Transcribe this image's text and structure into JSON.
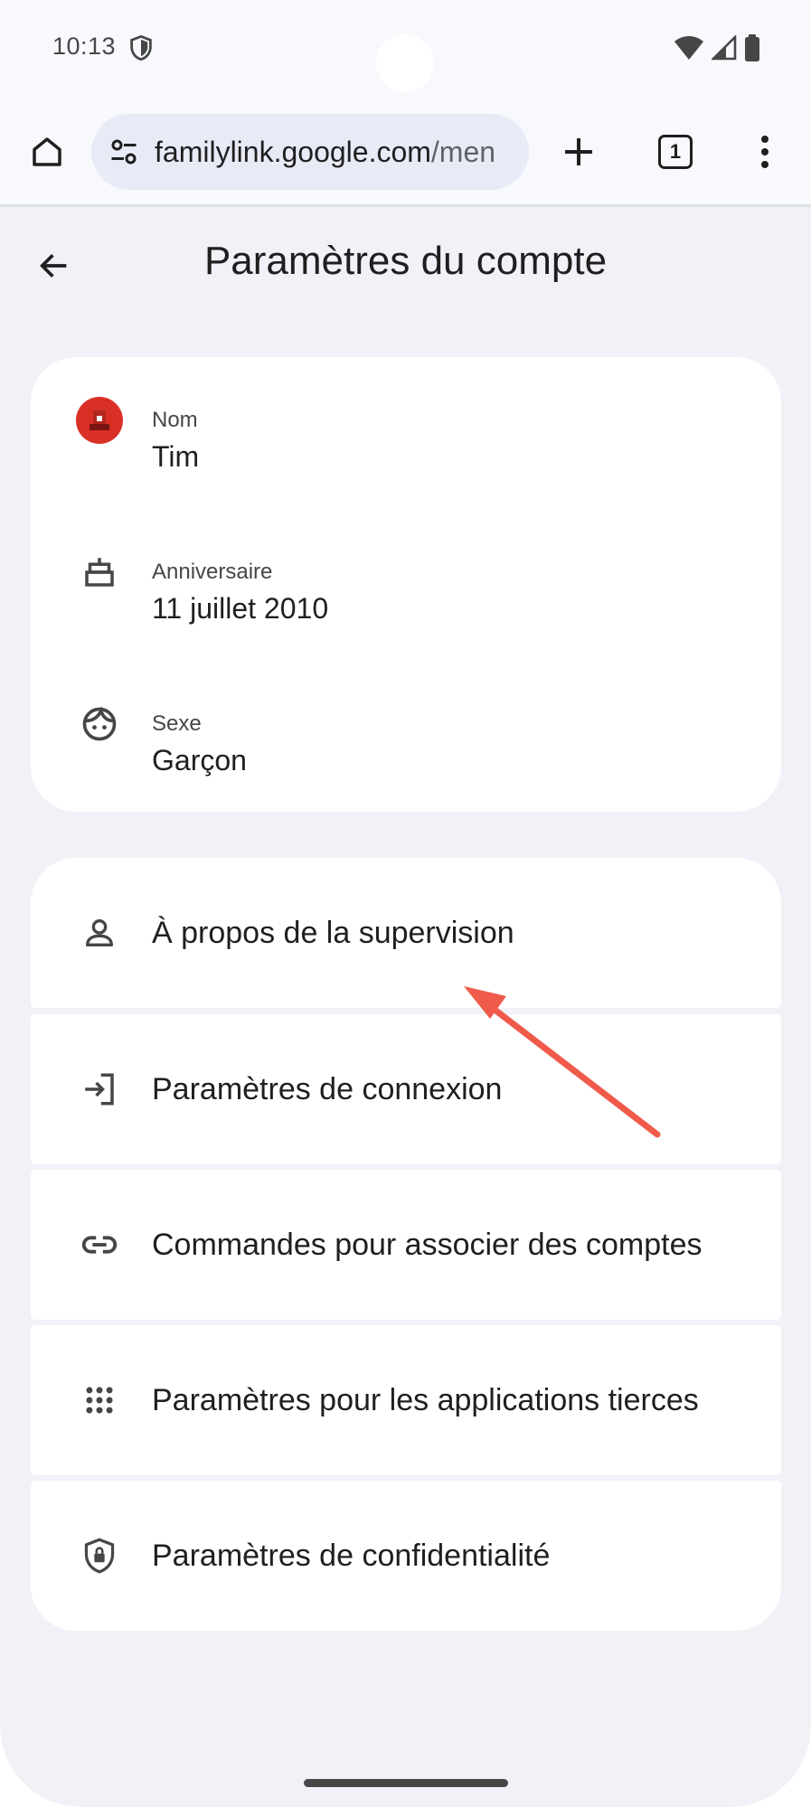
{
  "status_bar": {
    "time": "10:13"
  },
  "browser": {
    "url_main": "familylink.google.com",
    "url_rest": "/men",
    "tab_count": "1"
  },
  "page": {
    "title": "Paramètres du compte"
  },
  "profile": {
    "name_label": "Nom",
    "name_value": "Tim",
    "birthday_label": "Anniversaire",
    "birthday_value": "11 juillet 2010",
    "gender_label": "Sexe",
    "gender_value": "Garçon"
  },
  "menu": {
    "items": [
      {
        "label": "À propos de la supervision",
        "icon": "person-icon"
      },
      {
        "label": "Paramètres de connexion",
        "icon": "login-icon"
      },
      {
        "label": "Commandes pour associer des comptes",
        "icon": "link-icon"
      },
      {
        "label": "Paramètres pour les applications tierces",
        "icon": "apps-grid-icon"
      },
      {
        "label": "Paramètres de confidentialité",
        "icon": "privacy-shield-icon"
      }
    ]
  },
  "colors": {
    "background": "#f0f2f7",
    "card": "#ffffff",
    "url_pill": "#e8eaf6",
    "arrow": "#ef5a4a",
    "avatar": "#d93025"
  }
}
